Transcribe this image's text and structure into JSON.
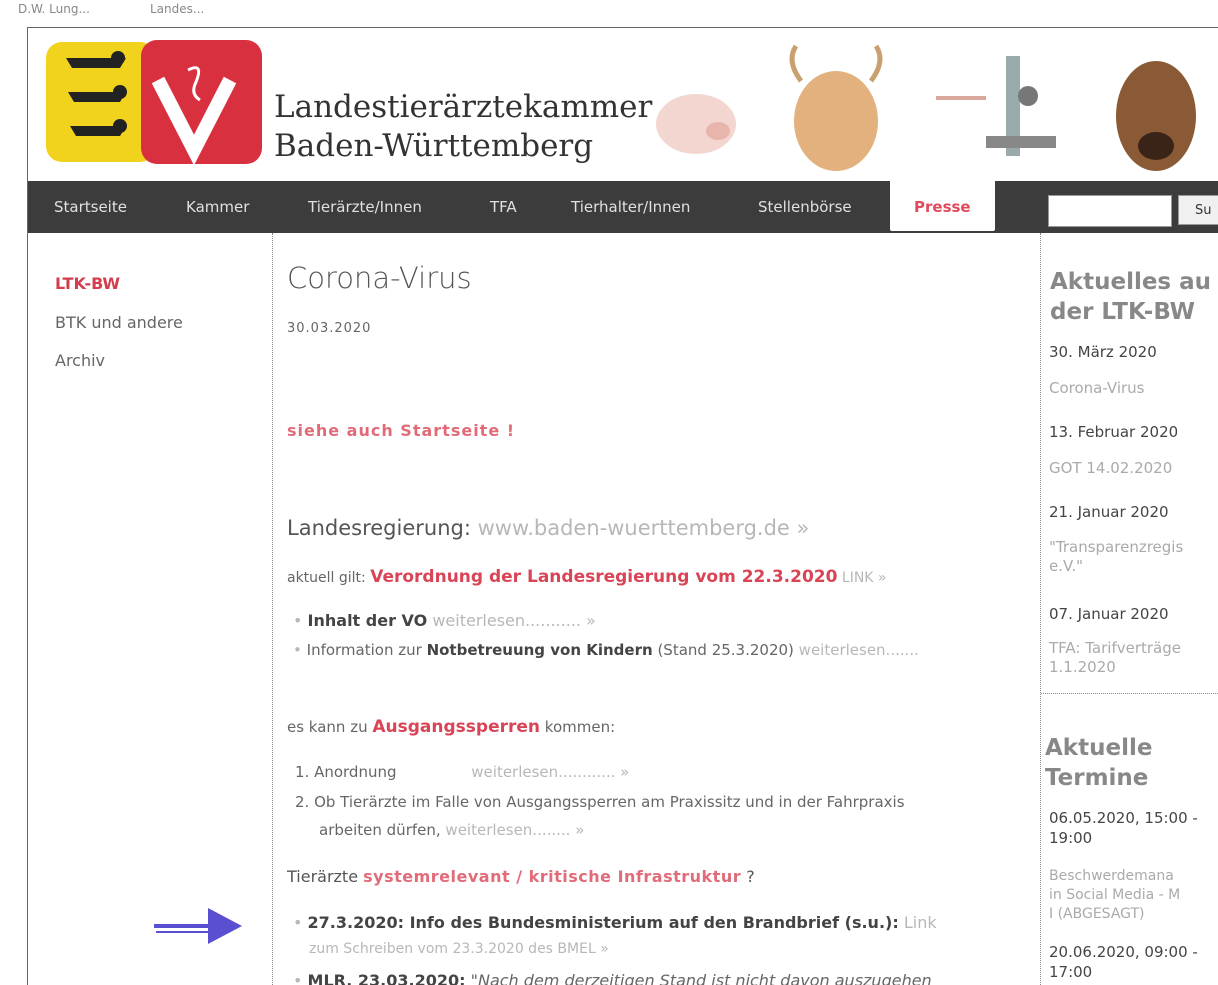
{
  "org": {
    "line1": "Landestierärztekammer",
    "line2": "Baden-Württemberg"
  },
  "nav": {
    "items": [
      "Startseite",
      "Kammer",
      "Tierärzte/Innen",
      "TFA",
      "Tierhalter/Innen",
      "Stellenbörse"
    ],
    "active": "Presse",
    "search_button": "Su"
  },
  "sidebar": {
    "items": [
      "LTK-BW",
      "BTK und andere",
      "Archiv"
    ]
  },
  "main": {
    "title": "Corona-Virus",
    "date": "30.03.2020",
    "see_also": "siehe auch Startseite !",
    "gov_label": "Landesregierung:",
    "gov_link": "www.baden-wuerttemberg.de »",
    "current_prefix": "aktuell gilt:",
    "current_link": "Verordnung der Landesregierung vom 22.3.2020",
    "current_link_suffix": "LINK »",
    "b1_bold": "Inhalt der VO",
    "b1_more": "weiterlesen........... »",
    "b2_pre": "Information zur",
    "b2_bold": "Notbetreuung von Kindern",
    "b2_post": "(Stand 25.3.2020)",
    "b2_more": "weiterlesen.......",
    "curfew_pre": "es kann zu",
    "curfew_link": "Ausgangssperren",
    "curfew_post": "kommen:",
    "ol1": "1. Anordnung",
    "ol1_more": "weiterlesen............ »",
    "ol2": "2. Ob Tierärzte im Falle von Ausgangssperren am Praxissitz und in der Fahrpraxis",
    "ol2b": "arbeiten dürfen,",
    "ol2_more": "weiterlesen........ »",
    "sys_pre": "Tierärzte",
    "sys_link": "systemrelevant / kritische Infrastruktur",
    "sys_post": "?",
    "i1_bold": "27.3.2020: Info des Bundesministerium auf den Brandbrief (s.u.):",
    "i1_more": "Link",
    "i1_line2": "zum Schreiben vom 23.3.2020 des BMEL »",
    "i2_bold": "MLR, 23.03.2020:",
    "i2_text": "\"Nach dem derzeitigen Stand ist nicht davon auszugehen"
  },
  "right": {
    "news_head1": "Aktuelles au",
    "news_head2": "der LTK-BW",
    "news": [
      {
        "date": "30. März 2020",
        "link": "Corona-Virus"
      },
      {
        "date": "13. Februar 2020",
        "link": "GOT 14.02.2020"
      },
      {
        "date": "21. Januar 2020",
        "link": "\"Transparenzregis",
        "link2": "e.V.\""
      },
      {
        "date": "07. Januar 2020",
        "link": "TFA: Tarifverträge",
        "link2": "1.1.2020"
      }
    ],
    "terms_head1": "Aktuelle",
    "terms_head2": "Termine",
    "terms": [
      {
        "date": "06.05.2020, 15:00 -",
        "date2": "19:00",
        "link": "Beschwerdemana",
        "link2": "in Social Media - M",
        "link3": "I (ABGESAGT)"
      },
      {
        "date": "20.06.2020, 09:00 -",
        "date2": "17:00"
      }
    ]
  },
  "top_scrap": {
    "left": "D.W. Lung...",
    "mid": "Landes..."
  }
}
